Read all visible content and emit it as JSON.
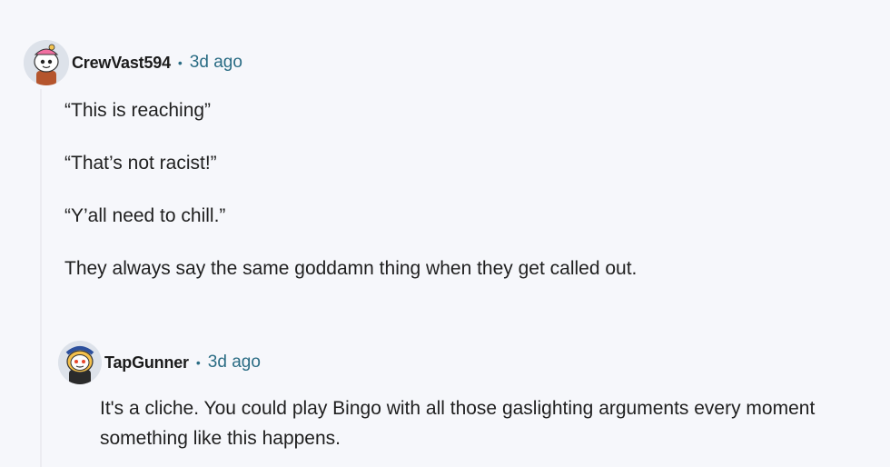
{
  "comments": [
    {
      "username": "CrewVast594",
      "separator": "•",
      "timestamp": "3d ago",
      "avatar_icon": "reddit-snoo-avatar-icon",
      "paragraphs": [
        "“This is reaching”",
        "“That’s not racist!”",
        "“Y’all need to chill.”",
        "They always say the same goddamn thing when they get called out."
      ]
    },
    {
      "username": "TapGunner",
      "separator": "•",
      "timestamp": "3d ago",
      "avatar_icon": "reddit-snoo-avatar-icon",
      "paragraphs": [
        "It's a cliche. You could play Bingo with all those gaslighting arguments every moment something like this happens."
      ]
    }
  ],
  "colors": {
    "background": "#f6f7fb",
    "timestamp": "#2a6c84",
    "text": "#1f1f1f"
  }
}
